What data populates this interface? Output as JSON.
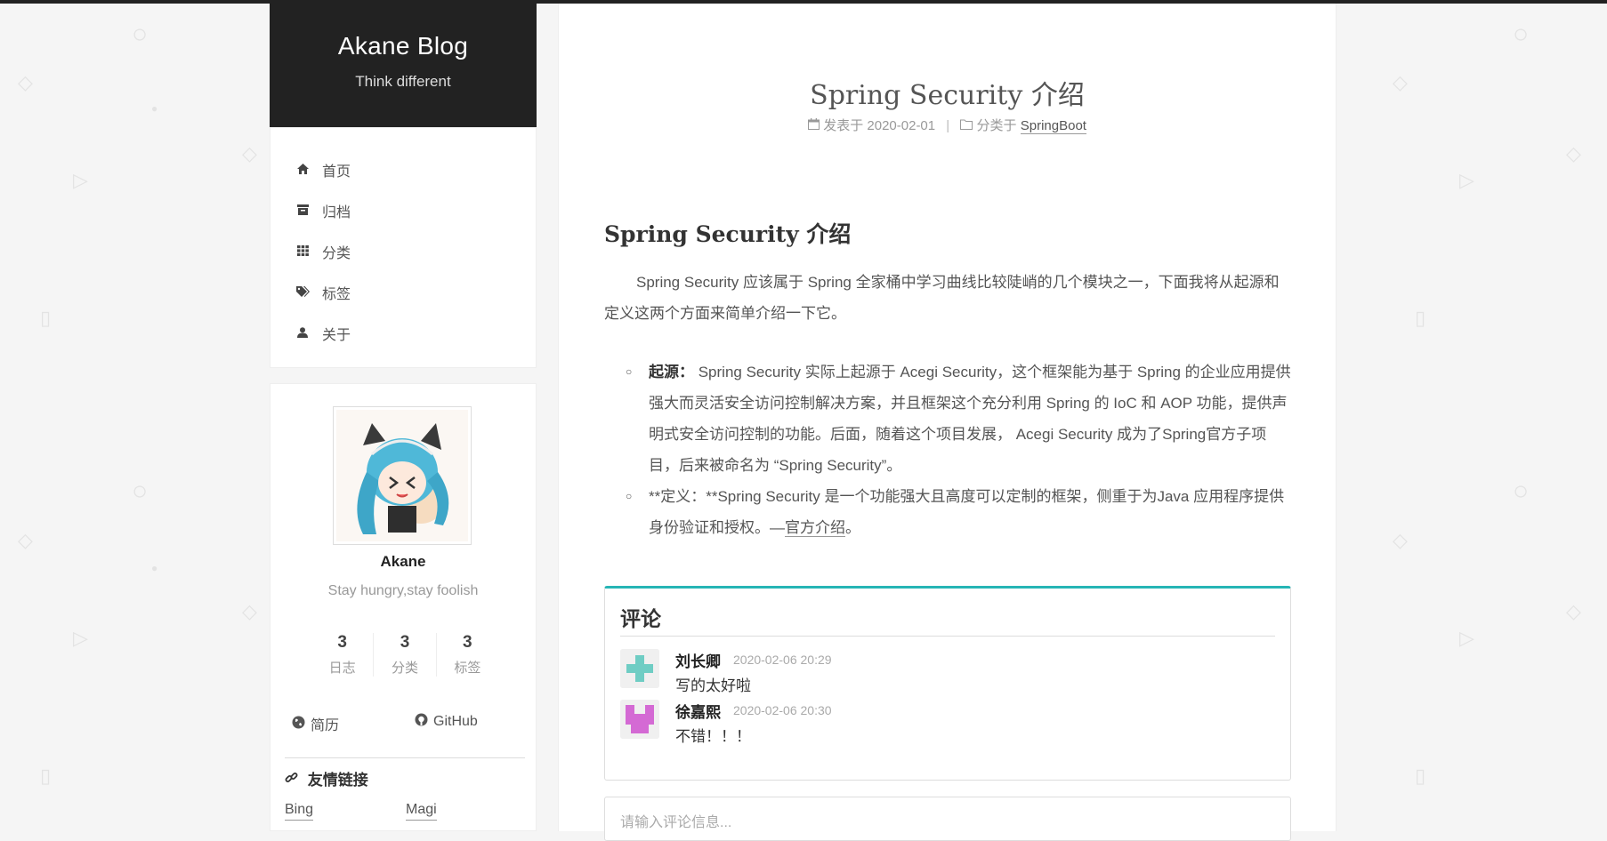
{
  "sidebar": {
    "brand_title": "Akane Blog",
    "brand_subtitle": "Think different",
    "menu": [
      {
        "label": "首页",
        "icon": "home-icon"
      },
      {
        "label": "归档",
        "icon": "archive-icon"
      },
      {
        "label": "分类",
        "icon": "th-icon"
      },
      {
        "label": "标签",
        "icon": "tags-icon"
      },
      {
        "label": "关于",
        "icon": "user-icon"
      }
    ],
    "profile": {
      "name": "Akane",
      "motto": "Stay hungry,stay foolish",
      "stats": [
        {
          "num": "3",
          "label": "日志"
        },
        {
          "num": "3",
          "label": "分类"
        },
        {
          "num": "3",
          "label": "标签"
        }
      ],
      "links": [
        {
          "label": "简历",
          "icon": "globe-icon"
        },
        {
          "label": "GitHub",
          "icon": "github-icon"
        }
      ],
      "friends_title": "友情链接",
      "friends": [
        "Bing",
        "Magi"
      ]
    }
  },
  "post": {
    "title": "Spring Security 介绍",
    "meta_published_label": "发表于",
    "meta_date": "2020-02-01",
    "meta_category_label": "分类于",
    "meta_category": "SpringBoot",
    "heading": "Spring Security 介绍",
    "paragraph": "Spring Security 应该属于 Spring 全家桶中学习曲线比较陡峭的几个模块之一，下面我将从起源和定义这两个方面来简单介绍一下它。",
    "list": [
      {
        "bold": "起源：",
        "text": " Spring Security 实际上起源于 Acegi Security，这个框架能为基于 Spring 的企业应用提供强大而灵活安全访问控制解决方案，并且框架这个充分利用 Spring 的 IoC 和 AOP 功能，提供声明式安全访问控制的功能。后面，随着这个项目发展， Acegi Security 成为了Spring官方子项目，后来被命名为 “Spring Security”。"
      },
      {
        "text": "**定义：**Spring Security 是一个功能强大且高度可以定制的框架，侧重于为Java 应用程序提供身份验证和授权。—",
        "link": "官方介绍",
        "tail": "。"
      }
    ]
  },
  "comments": {
    "title": "评论",
    "items": [
      {
        "name": "刘长卿",
        "time": "2020-02-06 20:29",
        "text": "写的太好啦",
        "avatar_color": "#6fcdc4"
      },
      {
        "name": "徐嘉熙",
        "time": "2020-02-06 20:30",
        "text": "不错！！！",
        "avatar_color": "#d46ad4"
      }
    ],
    "input_placeholder": "请输入评论信息..."
  },
  "colors": {
    "accent": "#26b5b5",
    "header_bg": "#222222"
  }
}
